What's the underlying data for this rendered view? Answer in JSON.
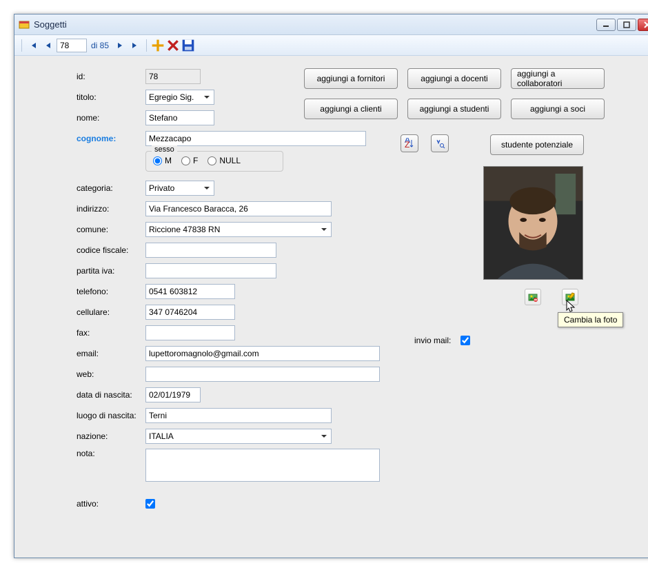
{
  "window": {
    "title": "Soggetti"
  },
  "nav": {
    "current": "78",
    "of_label": "di 85"
  },
  "buttons": {
    "fornitori": "aggiungi a fornitori",
    "docenti": "aggiungi a docenti",
    "collaboratori": "aggiungi a collaboratori",
    "clienti": "aggiungi a clienti",
    "studenti": "aggiungi a studenti",
    "soci": "aggiungi a soci",
    "studente_potenziale": "studente potenziale"
  },
  "labels": {
    "id": "id:",
    "titolo": "titolo:",
    "nome": "nome:",
    "cognome": "cognome:",
    "sesso": "sesso",
    "categoria": "categoria:",
    "indirizzo": "indirizzo:",
    "comune": "comune:",
    "codice_fiscale": "codice fiscale:",
    "partita_iva": "partita iva:",
    "telefono": "telefono:",
    "cellulare": "cellulare:",
    "fax": "fax:",
    "email": "email:",
    "web": "web:",
    "data_nascita": "data di nascita:",
    "luogo_nascita": "luogo di nascita:",
    "nazione": "nazione:",
    "nota": "nota:",
    "attivo": "attivo:",
    "invio_mail": "invio mail:"
  },
  "values": {
    "id": "78",
    "titolo": "Egregio Sig.",
    "nome": "Stefano",
    "cognome": "Mezzacapo",
    "sesso": "M",
    "categoria": "Privato",
    "indirizzo": "Via Francesco Baracca, 26",
    "comune": "Riccione 47838 RN",
    "codice_fiscale": "",
    "partita_iva": "",
    "telefono": "0541 603812",
    "cellulare": "347 0746204",
    "fax": "",
    "email": "lupettoromagnolo@gmail.com",
    "web": "",
    "data_nascita": "02/01/1979",
    "luogo_nascita": "Terni",
    "nazione": "ITALIA",
    "nota": "",
    "attivo": true,
    "invio_mail": true
  },
  "radios": {
    "m": "M",
    "f": "F",
    "null": "NULL"
  },
  "tooltip": "Cambia la foto"
}
